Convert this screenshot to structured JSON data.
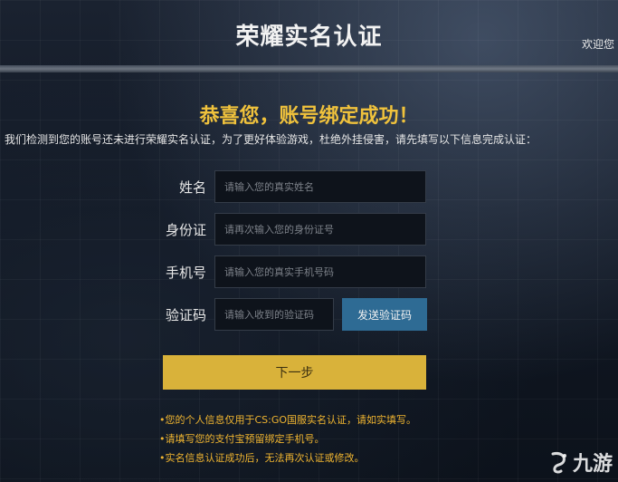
{
  "header": {
    "title": "荣耀实名认证",
    "welcome": "欢迎您"
  },
  "main": {
    "congrats": "恭喜您，账号绑定成功！",
    "notice": "我们检测到您的账号还未进行荣耀实名认证，为了更好体验游戏，杜绝外挂侵害，请先填写以下信息完成认证：",
    "fields": {
      "name": {
        "label": "姓名",
        "placeholder": "请输入您的真实姓名"
      },
      "id": {
        "label": "身份证",
        "placeholder": "请再次输入您的身份证号"
      },
      "phone": {
        "label": "手机号",
        "placeholder": "请输入您的真实手机号码"
      },
      "code": {
        "label": "验证码",
        "placeholder": "请输入收到的验证码"
      }
    },
    "send_code_label": "发送验证码",
    "next_label": "下一步",
    "tips": [
      "•您的个人信息仅用于CS:GO国服实名认证，请如实填写。",
      "•请填写您的支付宝预留绑定手机号。",
      "•实名信息认证成功后，无法再次认证或修改。"
    ]
  },
  "watermark": {
    "text": "九游"
  },
  "colors": {
    "accent_gold": "#f0c23c",
    "button_blue": "#2e6b94",
    "button_gold": "#d9b23a"
  }
}
